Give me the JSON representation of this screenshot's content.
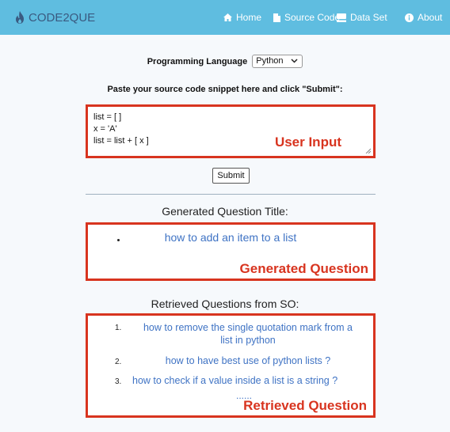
{
  "navbar": {
    "brand": "CODE2QUE",
    "items": [
      {
        "label": "Home",
        "icon": "home-icon"
      },
      {
        "label": "Source Code",
        "icon": "file-icon"
      },
      {
        "label": "Data Set",
        "icon": "database-icon"
      },
      {
        "label": "About",
        "icon": "info-icon"
      }
    ]
  },
  "form": {
    "language_label": "Programming Language",
    "language_selected": "Python",
    "instruction": "Paste your source code snippet here and click \"Submit\":",
    "code_lines": [
      "list = [ ]",
      "x = 'A'",
      "list = list + [ x ]"
    ],
    "submit_label": "Submit"
  },
  "annotations": {
    "user_input": "User Input",
    "generated_question": "Generated Question",
    "retrieved_question": "Retrieved Question"
  },
  "generated": {
    "heading": "Generated Question Title:",
    "title": "how to add an item to a list"
  },
  "retrieved": {
    "heading": "Retrieved Questions from SO:",
    "items": [
      {
        "num": "1.",
        "line1": "how to remove the single quotation mark from a",
        "line2": "list in python"
      },
      {
        "num": "2.",
        "line1": "how to have best use of python lists ?"
      },
      {
        "num": "3.",
        "line1": "how to check if a value inside a list is a string ?"
      }
    ],
    "more": "......"
  },
  "colors": {
    "navbar": "#5fbde0",
    "brand": "#3a5a80",
    "annotation_red": "#d8341f",
    "link_blue": "#3f73c4"
  }
}
